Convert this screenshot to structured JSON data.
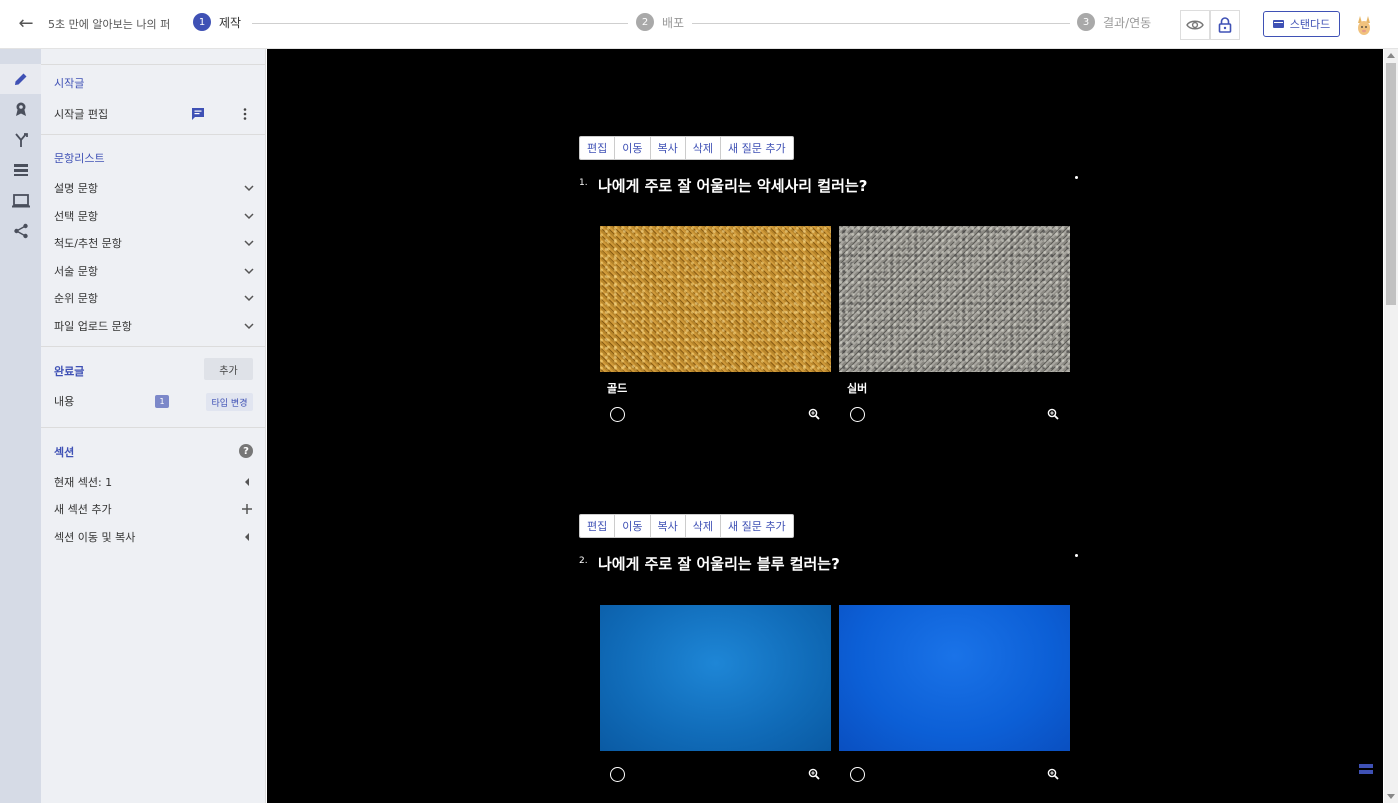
{
  "header": {
    "doc_title": "5초 만에 알아보는 나의 퍼",
    "steps": [
      {
        "num": "1",
        "label": "제작"
      },
      {
        "num": "2",
        "label": "배포"
      },
      {
        "num": "3",
        "label": "결과/연동"
      }
    ],
    "plan_label": "스탠다드"
  },
  "rail": {
    "icons": [
      "pencil-icon",
      "badge-icon",
      "branch-icon",
      "list-icon",
      "monitor-icon",
      "share-icon"
    ]
  },
  "panel": {
    "intro_title": "시작글",
    "intro_edit": "시작글 편집",
    "question_list_title": "문항리스트",
    "question_types": [
      "설명 문항",
      "선택 문항",
      "척도/추천 문항",
      "서술 문항",
      "순위 문항",
      "파일 업로드 문항"
    ],
    "completion_title": "완료글",
    "completion_add": "추가",
    "completion_content": "내용",
    "completion_badge": "1",
    "completion_type_change": "타입 변경",
    "section_title": "섹션",
    "section_help": "?",
    "section_current": "현재 섹션: 1",
    "section_add": "새 섹션 추가",
    "section_move_copy": "섹션 이동 및 복사"
  },
  "toolbar": {
    "edit": "편집",
    "move": "이동",
    "copy": "복사",
    "delete": "삭제",
    "add_question": "새 질문 추가"
  },
  "questions": [
    {
      "num": "1.",
      "title": "나에게 주로 잘 어울리는 악세사리 컬러는?",
      "options": [
        {
          "label": "골드"
        },
        {
          "label": "실버"
        }
      ]
    },
    {
      "num": "2.",
      "title": "나에게 주로 잘 어울리는 블루 컬러는?",
      "options": [
        {
          "label": ""
        },
        {
          "label": ""
        }
      ]
    }
  ]
}
